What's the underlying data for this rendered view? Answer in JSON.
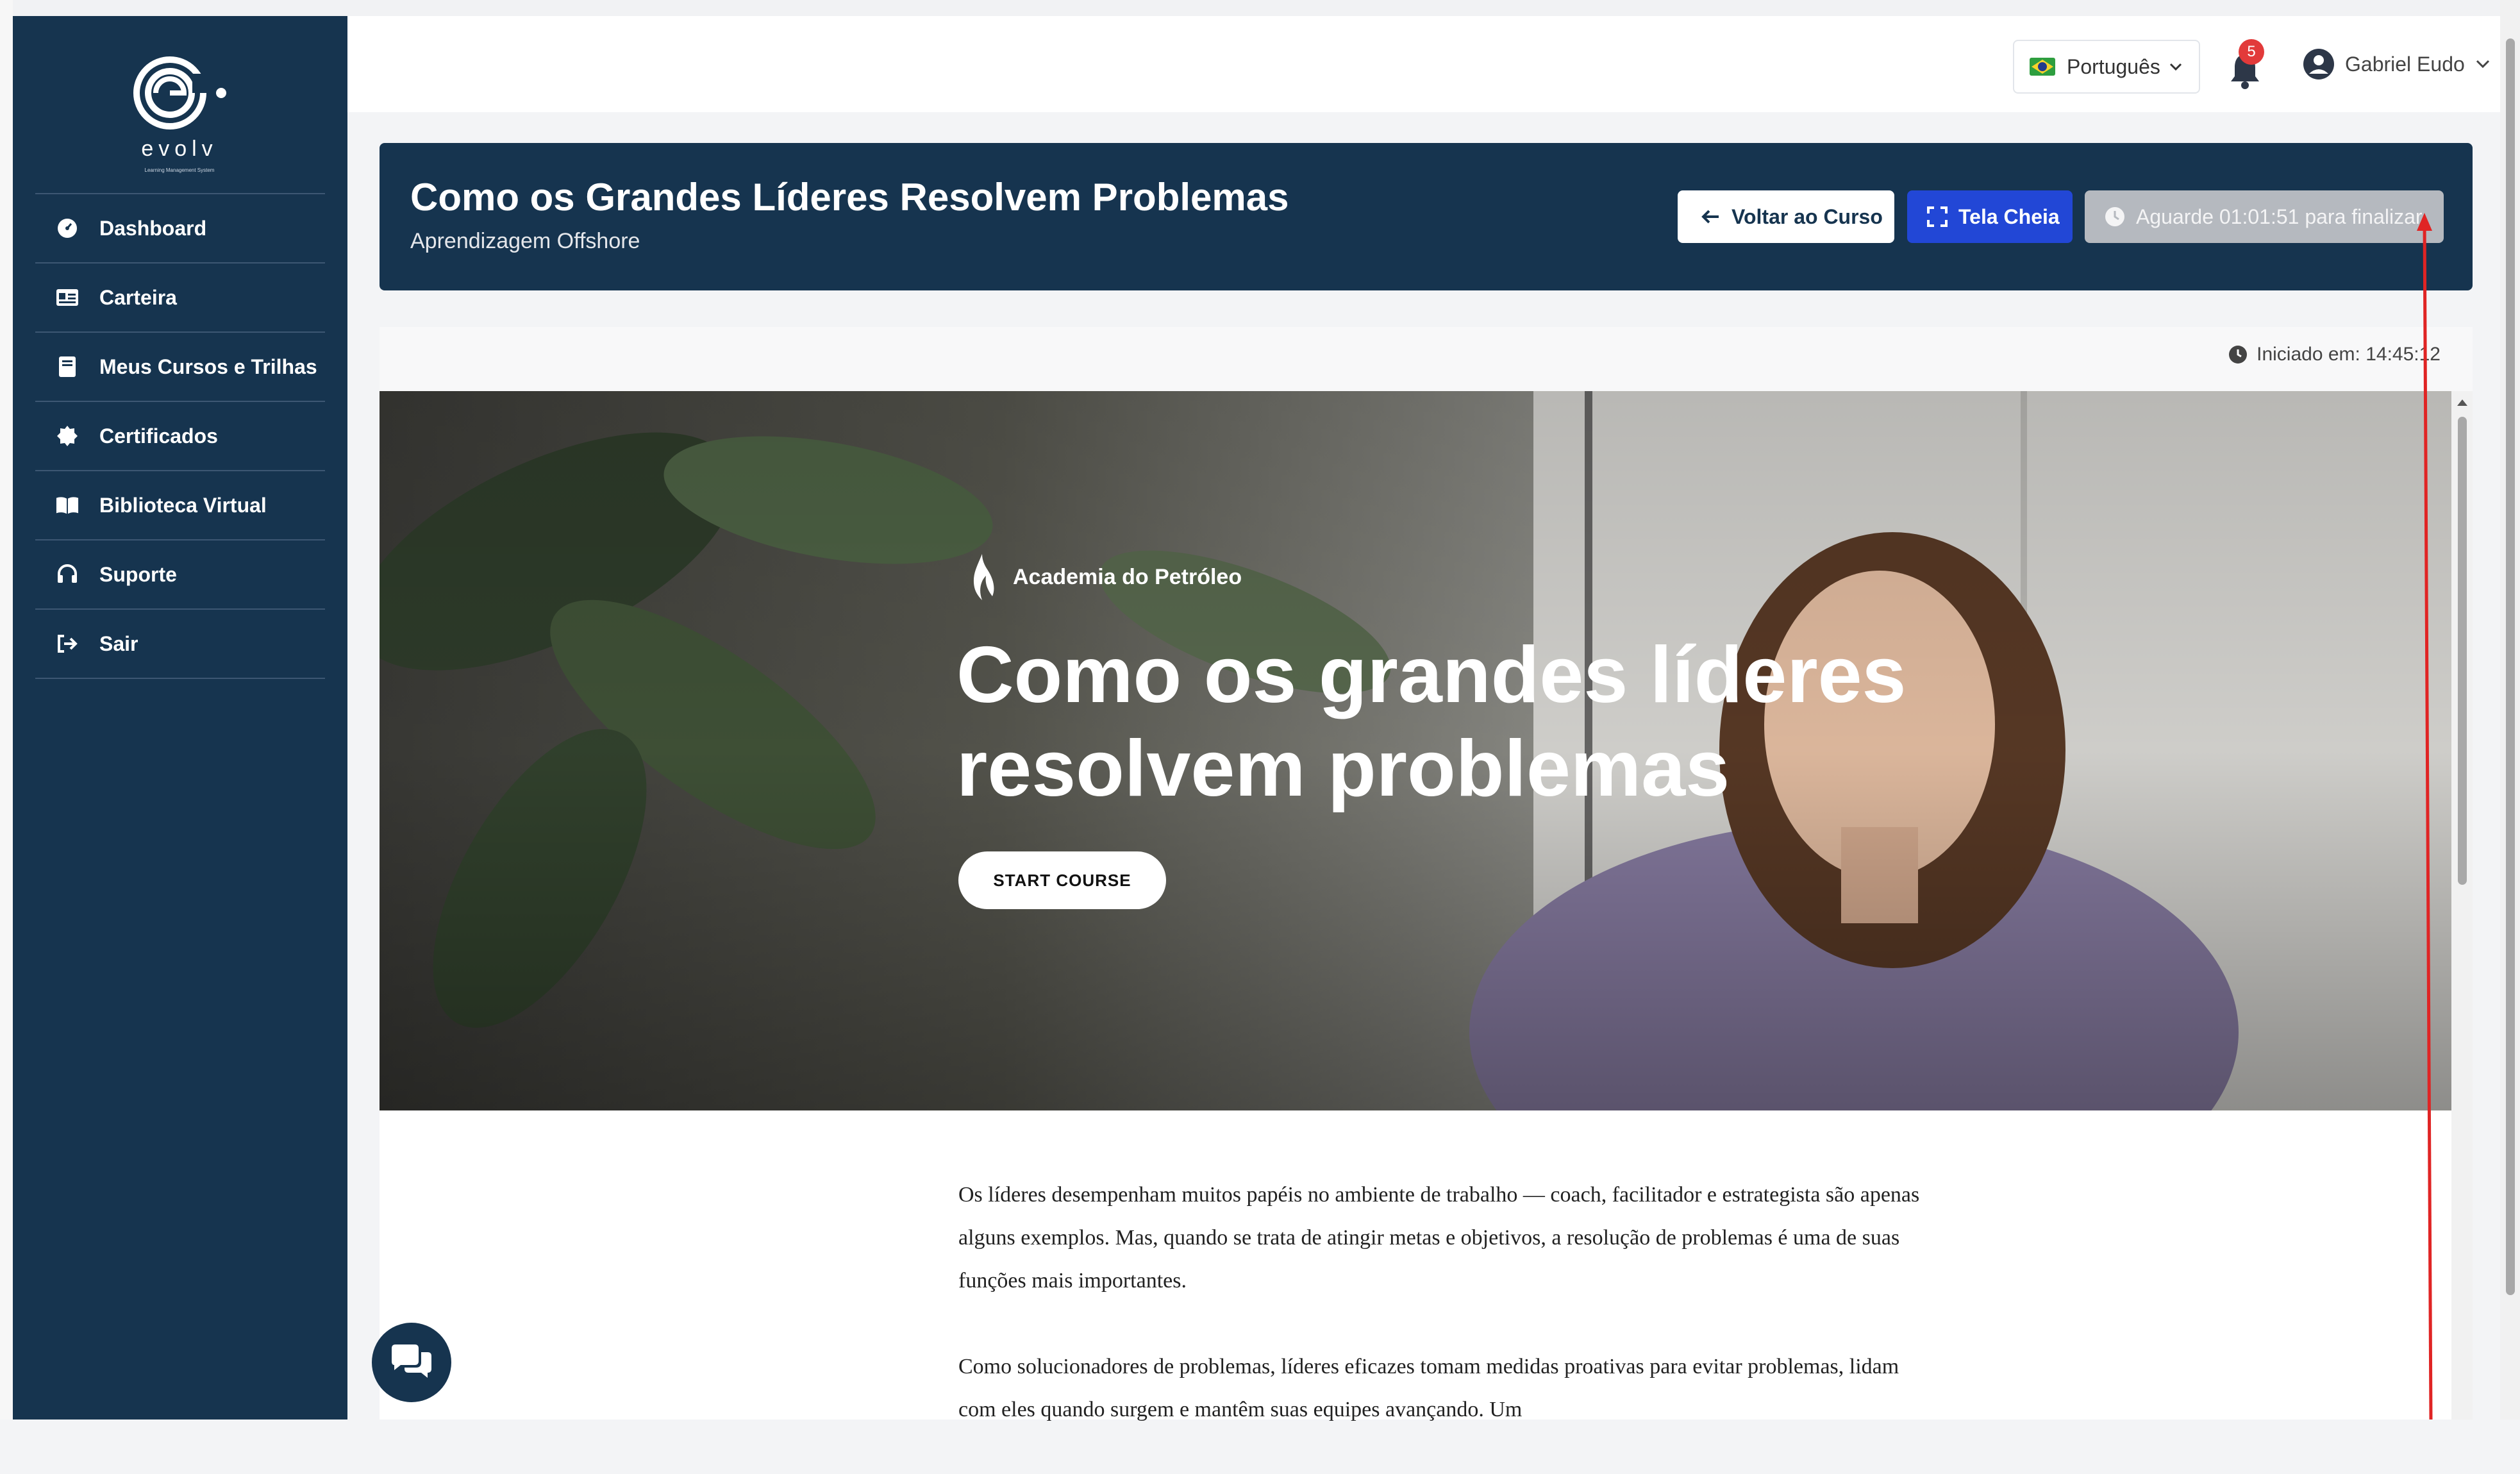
{
  "sidebar": {
    "logo_text": "evolv",
    "logo_subtitle": "Learning Management System",
    "items": [
      {
        "label": "Dashboard",
        "icon": "dashboard-icon"
      },
      {
        "label": "Carteira",
        "icon": "id-card-icon"
      },
      {
        "label": "Meus Cursos e Trilhas",
        "icon": "book-icon"
      },
      {
        "label": "Certificados",
        "icon": "certificate-icon"
      },
      {
        "label": "Biblioteca Virtual",
        "icon": "open-book-icon"
      },
      {
        "label": "Suporte",
        "icon": "headset-icon"
      },
      {
        "label": "Sair",
        "icon": "logout-icon"
      }
    ]
  },
  "header": {
    "language": "Português",
    "notifications_count": "5",
    "user_name": "Gabriel Eudo"
  },
  "course": {
    "title": "Como os Grandes Líderes Resolvem Problemas",
    "subtitle": "Aprendizagem Offshore",
    "back_label": "Voltar ao Curso",
    "fullscreen_label": "Tela Cheia",
    "wait_label": "Aguarde 01:01:51 para finalizar",
    "started_label": "Iniciado em: 14:45:12"
  },
  "hero": {
    "brand": "Academia do Petróleo",
    "title_line1": "Como os grandes líderes",
    "title_line2": "resolvem problemas",
    "cta": "START COURSE"
  },
  "article": {
    "p1": "Os líderes desempenham muitos papéis no ambiente de trabalho — coach, facilitador e estrategista são apenas alguns exemplos. Mas, quando se trata de atingir metas e objetivos, a resolução de problemas é uma de suas funções mais importantes.",
    "p2": "Como solucionadores de problemas, líderes eficazes tomam medidas proativas para evitar problemas, lidam com eles quando surgem e mantêm suas equipes avançando. Um"
  },
  "colors": {
    "navy": "#16344f",
    "primary_blue": "#2247d6",
    "disabled_gray": "#b5b9bf",
    "badge_red": "#e23a3a",
    "annotation_red": "#e02424"
  }
}
